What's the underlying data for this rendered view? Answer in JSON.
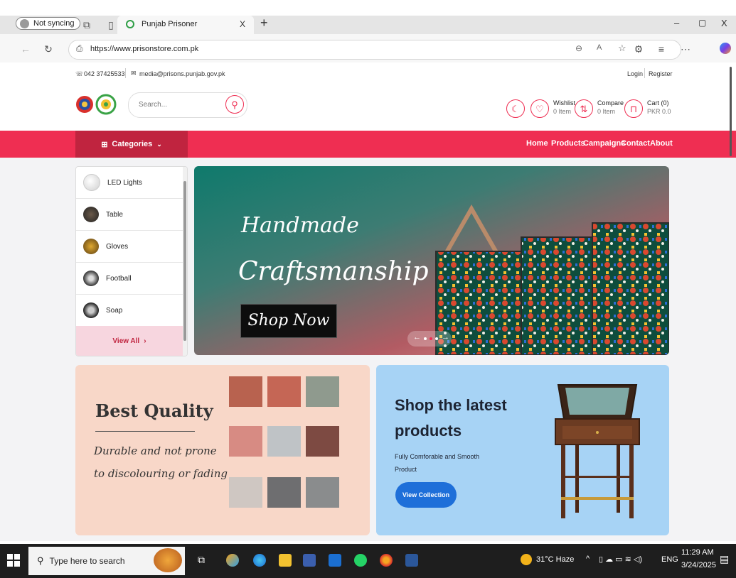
{
  "browser": {
    "profile_label": "Not syncing",
    "tab_title": "Punjab Prisoner",
    "tab_close": "X",
    "new_tab": "+",
    "window_controls": {
      "minimize": "–",
      "restore": "▢",
      "close": "X"
    },
    "url": "https://www.prisonstore.com.pk"
  },
  "topbar": {
    "phone": "042 37425533",
    "email": "media@prisons.punjab.gov.pk",
    "login": "Login",
    "register": "Register"
  },
  "header": {
    "search_placeholder": "Search...",
    "wishlist": {
      "label": "Wishlist",
      "count": "0 Item"
    },
    "compare": {
      "label": "Compare",
      "count": "0 Item"
    },
    "cart": {
      "label": "Cart (0)",
      "amount": "PKR 0.0"
    }
  },
  "nav": {
    "categories_label": "Categories",
    "links": [
      "Home",
      "Products",
      "Campaigns",
      "Contact",
      "About"
    ]
  },
  "categories": {
    "items": [
      "LED Lights",
      "Table",
      "Gloves",
      "Football",
      "Soap"
    ],
    "view_all": "View All"
  },
  "hero": {
    "line1": "Handmade",
    "line2": "Craftsmanship",
    "button": "Shop Now"
  },
  "promo_left": {
    "title": "Best Quality",
    "line1": "Durable and not prone",
    "line2": "to discolouring or fading"
  },
  "promo_right": {
    "title_line1": "Shop the latest",
    "title_line2": "products",
    "desc_line1": "Fully Comforable and Smooth",
    "desc_line2": "Product",
    "button": "View Collection"
  },
  "taskbar": {
    "search_placeholder": "Type here to search",
    "weather": "31°C Haze",
    "language": "ENG",
    "time": "11:29 AM",
    "date": "3/24/2025"
  },
  "colors": {
    "brand": "#ef2e52",
    "brand_dark": "#c0243f",
    "promo_left_bg": "#f8d7c8",
    "promo_right_bg": "#a7d3f5",
    "collection_button": "#1e6fd9"
  }
}
